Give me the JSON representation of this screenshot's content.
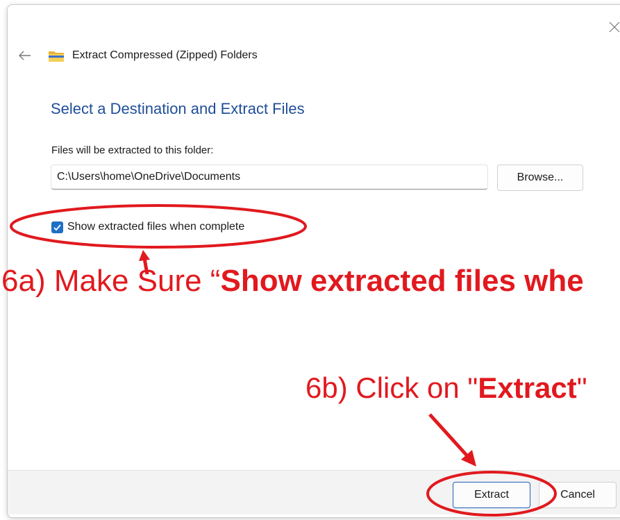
{
  "dialog": {
    "title": "Extract Compressed (Zipped) Folders",
    "heading": "Select a Destination and Extract Files",
    "destination_label": "Files will be extracted to this folder:",
    "destination_path": "C:\\Users\\home\\OneDrive\\Documents",
    "browse_label": "Browse...",
    "show_files_label": "Show extracted files when complete",
    "show_files_checked": true,
    "extract_label": "Extract",
    "cancel_label": "Cancel",
    "icons": {
      "close": "close-icon",
      "back": "back-arrow-icon",
      "folder": "zip-folder-icon",
      "checkbox": "checkmark-icon"
    }
  },
  "annotations": {
    "step_a_prefix": "6a) Make Sure “",
    "step_a_bold": "Show extracted files whe",
    "step_b_prefix": "6b) Click on \"",
    "step_b_bold": "Extract",
    "step_b_suffix": "\"",
    "color": "#e1191e"
  },
  "colors": {
    "accent": "#1f6fc4",
    "heading": "#1f4e99",
    "annotation": "#e1191e"
  }
}
